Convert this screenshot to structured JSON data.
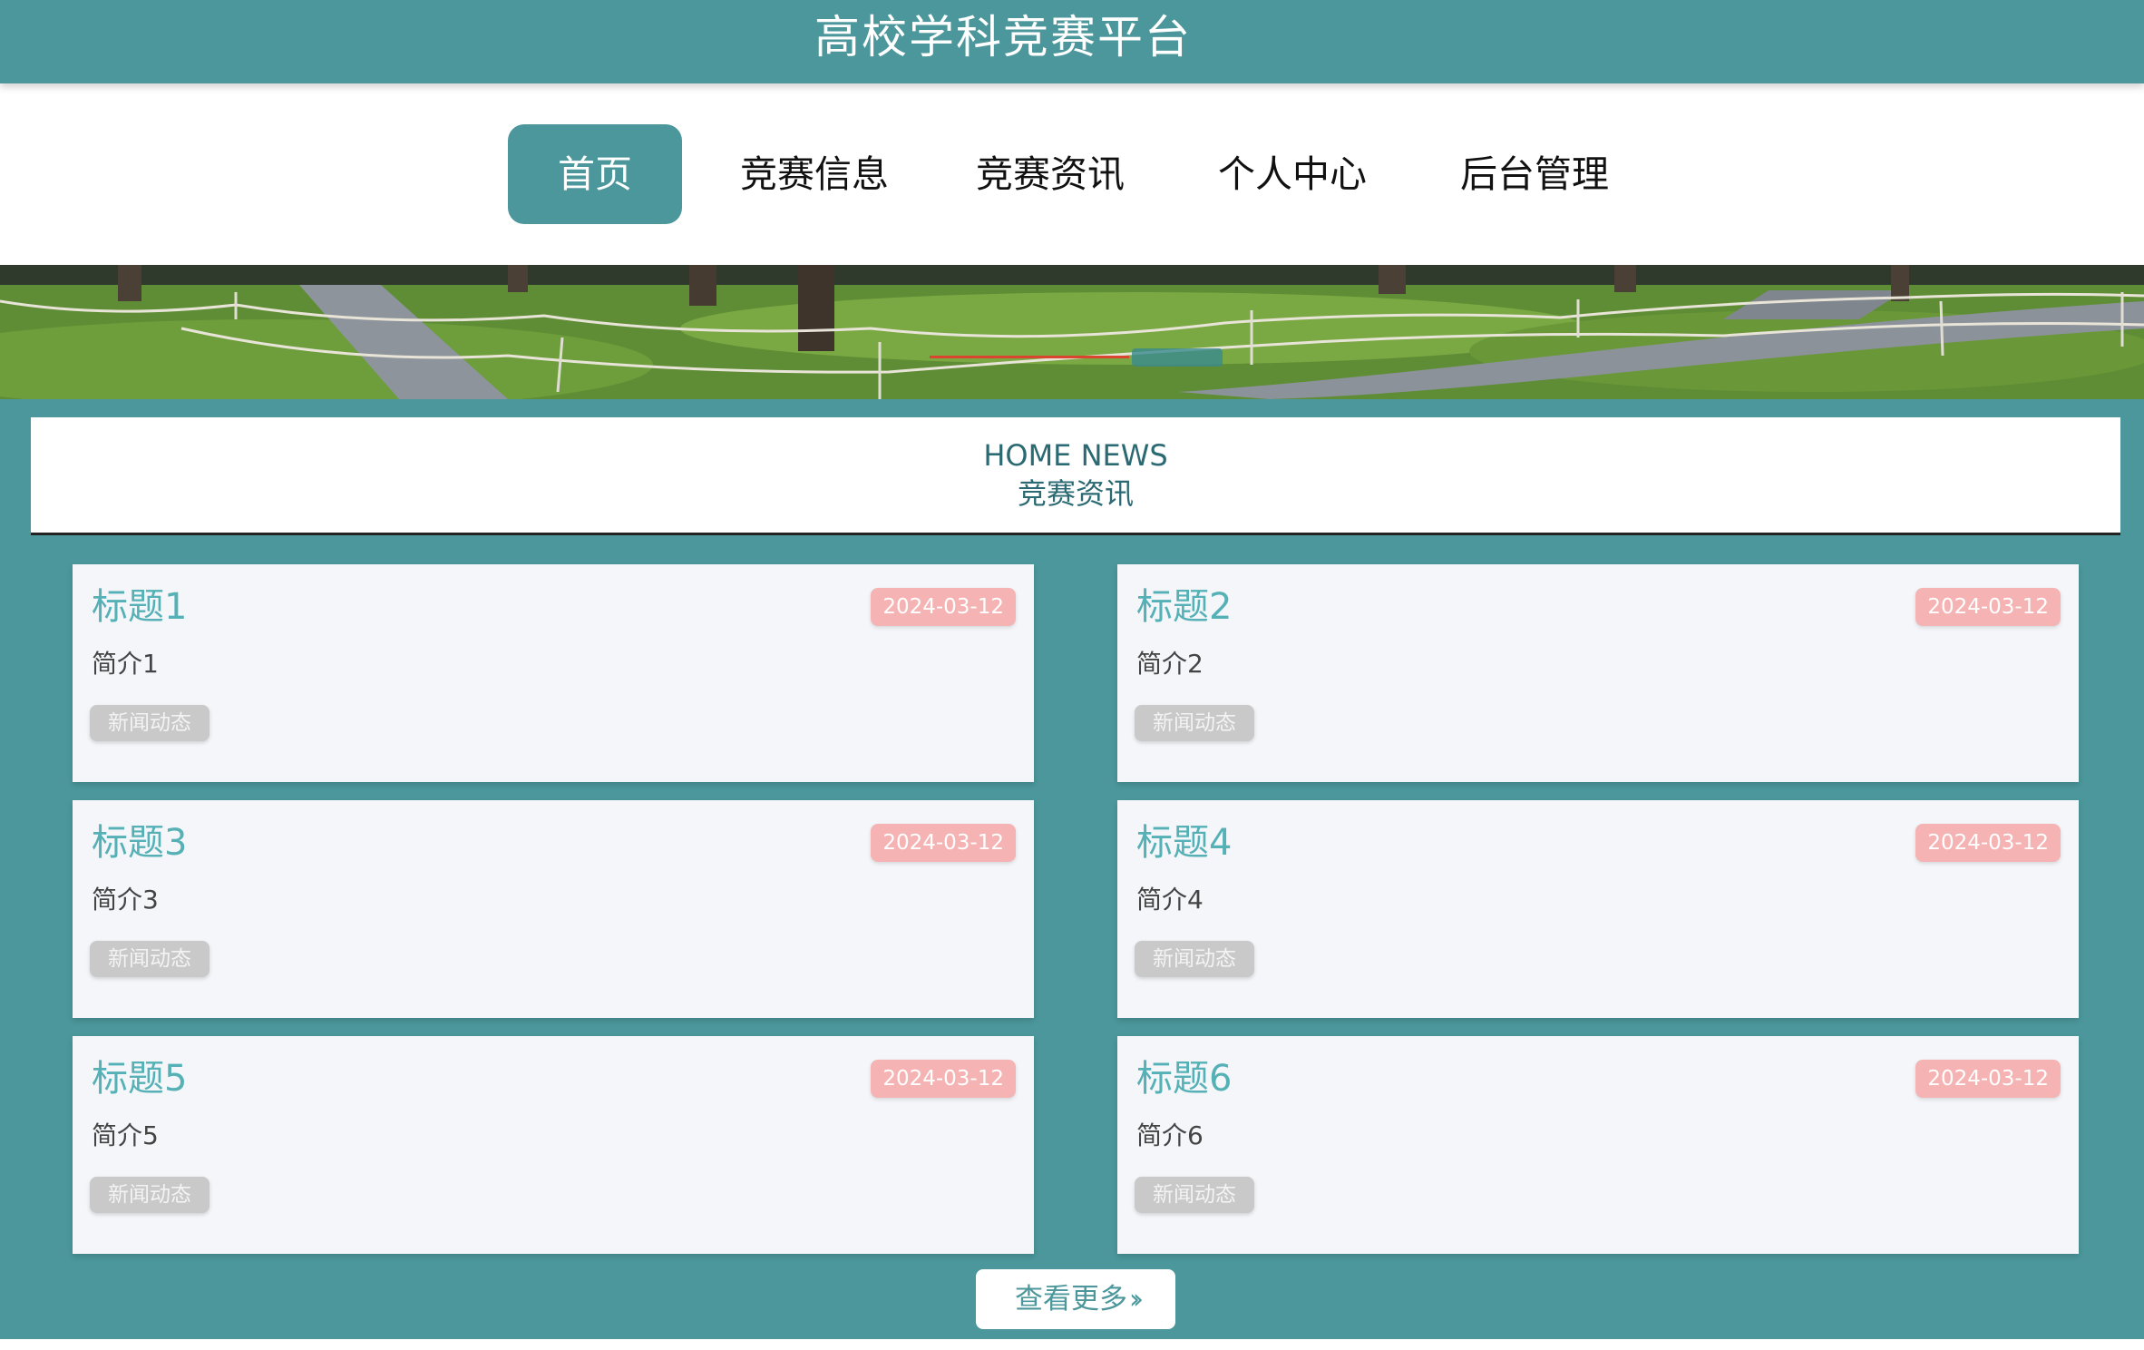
{
  "header": {
    "title": "高校学科竞赛平台"
  },
  "nav": {
    "items": [
      {
        "label": "首页",
        "active": true
      },
      {
        "label": "竞赛信息",
        "active": false
      },
      {
        "label": "竞赛资讯",
        "active": false
      },
      {
        "label": "个人中心",
        "active": false
      },
      {
        "label": "后台管理",
        "active": false
      }
    ]
  },
  "section": {
    "title_en": "HOME NEWS",
    "title_cn": "竞赛资讯"
  },
  "news": [
    {
      "title": "标题1",
      "date": "2024-03-12",
      "summary": "简介1",
      "tag": "新闻动态"
    },
    {
      "title": "标题2",
      "date": "2024-03-12",
      "summary": "简介2",
      "tag": "新闻动态"
    },
    {
      "title": "标题3",
      "date": "2024-03-12",
      "summary": "简介3",
      "tag": "新闻动态"
    },
    {
      "title": "标题4",
      "date": "2024-03-12",
      "summary": "简介4",
      "tag": "新闻动态"
    },
    {
      "title": "标题5",
      "date": "2024-03-12",
      "summary": "简介5",
      "tag": "新闻动态"
    },
    {
      "title": "标题6",
      "date": "2024-03-12",
      "summary": "简介6",
      "tag": "新闻动态"
    }
  ],
  "more": {
    "label": "查看更多",
    "icon": "double-chevron-right-icon"
  },
  "colors": {
    "primary": "#4b979b",
    "title_accent": "#55b1b6",
    "date_badge": "#f5b3b3",
    "tag_badge": "#c9c9c9"
  }
}
